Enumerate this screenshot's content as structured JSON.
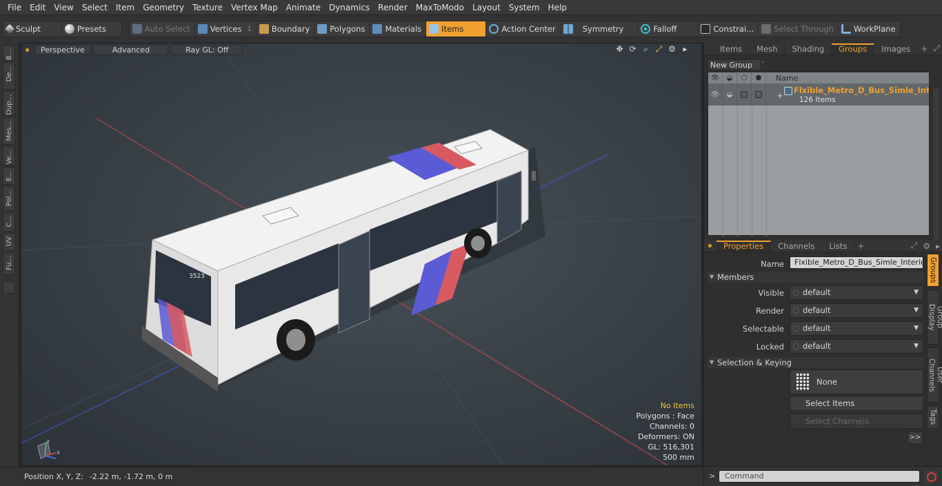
{
  "menu": [
    "File",
    "Edit",
    "View",
    "Select",
    "Item",
    "Geometry",
    "Texture",
    "Vertex Map",
    "Animate",
    "Dynamics",
    "Render",
    "MaxToModo",
    "Layout",
    "System",
    "Help"
  ],
  "toolbar": {
    "sculpt": "Sculpt",
    "presets": "Presets",
    "auto_select": "Auto Select",
    "vertices": "Vertices",
    "vertices_count": "1",
    "boundary": "Boundary",
    "polygons": "Polygons",
    "materials": "Materials",
    "items": "Items",
    "action_center": "Action Center",
    "symmetry": "Symmetry",
    "falloff": "Falloff",
    "constraints": "Constrai...",
    "select_through": "Select Through",
    "workplane": "WorkPlane",
    "accent_color": "#f0a030"
  },
  "left_tabs": [
    "B...",
    "De...",
    "Dup...",
    "Mes...",
    "Ve...",
    "E...",
    "Pol...",
    "C...",
    "UV",
    "Fu..."
  ],
  "viewport": {
    "view_mode": "Perspective",
    "shading": "Advanced",
    "raygl": "Ray GL: Off",
    "bus_number": "3523",
    "info": {
      "items": "No Items",
      "polygons": "Polygons : Face",
      "channels": "Channels: 0",
      "deformers": "Deformers: ON",
      "gl": "GL: 516,301",
      "scale": "500 mm"
    },
    "axis_y": "Y",
    "axis_x": "X"
  },
  "status": {
    "label": "Position X, Y, Z:",
    "value": "-2.22 m, -1.72 m, 0 m"
  },
  "top_tabs": [
    "Items",
    "Mesh ...",
    "Shading",
    "Groups",
    "Images"
  ],
  "top_tabs_active": "Groups",
  "groups": {
    "new_group": "New Group",
    "name_header": "Name",
    "row_name": "Flxible_Metro_D_Bus_Simle_Int...",
    "row_count": "126 Items"
  },
  "bottom_tabs": [
    "Properties",
    "Channels",
    "Lists"
  ],
  "properties": {
    "name_label": "Name",
    "name_value": "Flxible_Metro_D_Bus_Simle_Interior (",
    "members_header": "Members",
    "visible_label": "Visible",
    "visible_value": "default",
    "render_label": "Render",
    "render_value": "default",
    "selectable_label": "Selectable",
    "selectable_value": "default",
    "locked_label": "Locked",
    "locked_value": "default",
    "selkey_header": "Selection & Keying",
    "none_label": "None",
    "select_items": "Select Items",
    "select_channels": "Select Channels",
    "expand": ">>"
  },
  "side_tabs": [
    "Groups",
    "Group Display",
    "User Channels",
    "Tags"
  ],
  "command": {
    "prompt": ">",
    "placeholder": "Command"
  }
}
